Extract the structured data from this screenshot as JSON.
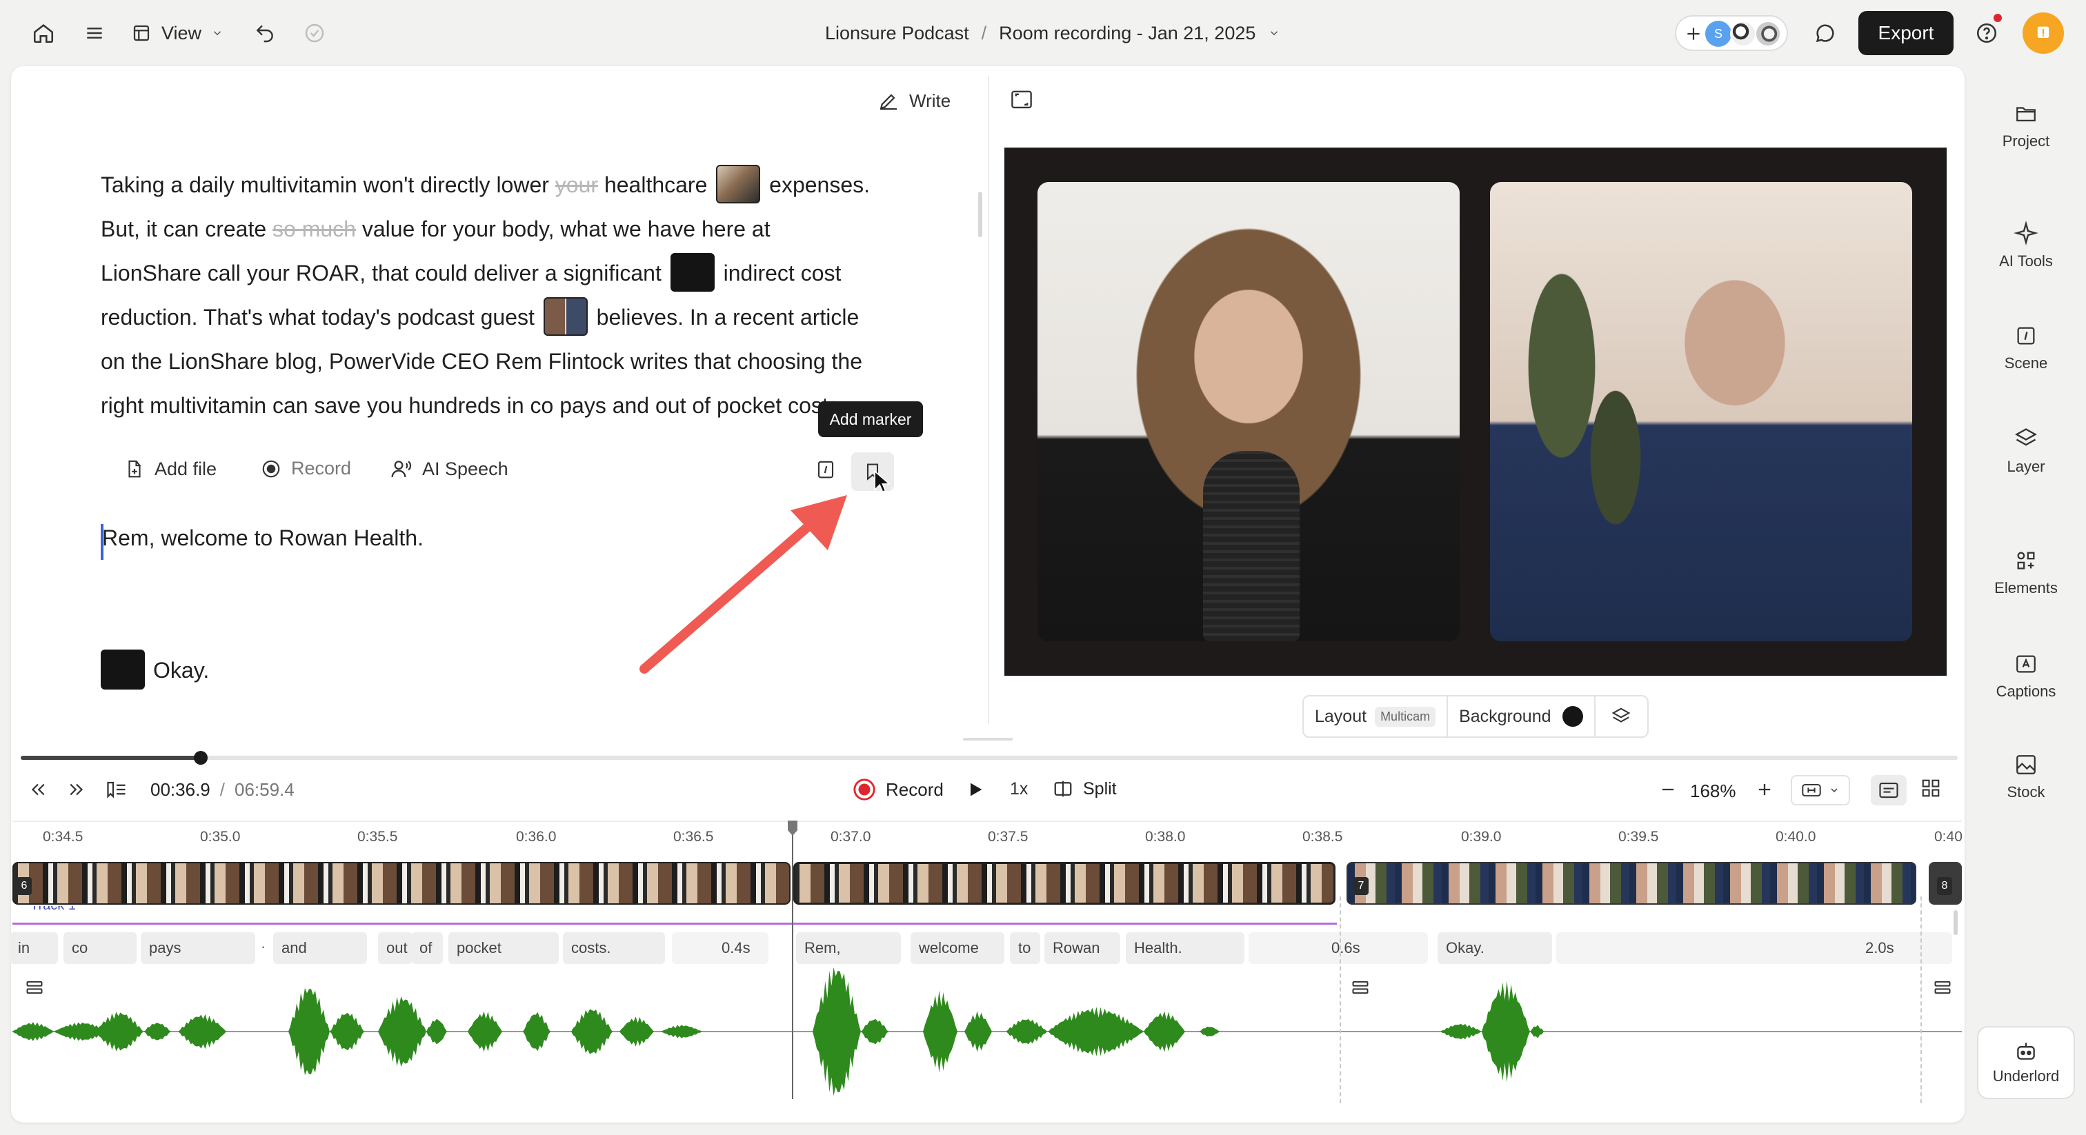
{
  "topbar": {
    "view_label": "View",
    "project_name": "Lionsure Podcast",
    "breadcrumb_sep": "/",
    "recording_name": "Room recording - Jan 21, 2025",
    "avatar_initial": "S",
    "export_label": "Export"
  },
  "editor": {
    "write_label": "Write",
    "paragraph1": {
      "l1a": "Taking a daily multivitamin won't directly lower",
      "l1_struck": "your",
      "l1b": "healthcare",
      "l1c": "expenses.",
      "l2a": "But, it can create",
      "l2_struck": "so much",
      "l2b": "value for your body, what we have here at",
      "l3a": "LionShare call your ROAR, that could deliver a significant",
      "l3b": "indirect cost",
      "l4a": "reduction. That's what today's podcast guest",
      "l4b": "believes. In a recent article",
      "l5": "on the LionShare blog, PowerVide CEO Rem Flintock writes that choosing the",
      "l6a": "right multivitamin can save you hundreds",
      "l6b": "in co pays and out of pocket costs."
    },
    "toolbar": {
      "add_file": "Add file",
      "record": "Record",
      "ai_speech": "AI Speech"
    },
    "tooltip": "Add marker",
    "paragraph2": "Rem, welcome to Rowan Health.",
    "paragraph3": "Okay."
  },
  "preview": {
    "layout_label": "Layout",
    "layout_value": "Multicam",
    "background_label": "Background",
    "background_color": "#1d1a19"
  },
  "sidebar": {
    "items": [
      {
        "label": "Project",
        "icon": "folder-icon"
      },
      {
        "label": "AI Tools",
        "icon": "sparkle-icon"
      },
      {
        "label": "Scene",
        "icon": "scene-icon"
      },
      {
        "label": "Layer",
        "icon": "layers-icon"
      },
      {
        "label": "Elements",
        "icon": "elements-icon"
      },
      {
        "label": "Captions",
        "icon": "captions-icon"
      },
      {
        "label": "Stock",
        "icon": "stock-icon"
      }
    ],
    "underlord_label": "Underlord"
  },
  "playback": {
    "current_time": "00:36.9",
    "sep": "/",
    "total_time": "06:59.4",
    "record_label": "Record",
    "speed": "1x",
    "split_label": "Split",
    "zoom": "168%",
    "progress": 0.093
  },
  "timeline": {
    "ruler": [
      "0:34.5",
      "0:35.0",
      "0:35.5",
      "0:36.0",
      "0:36.5",
      "0:37.0",
      "0:37.5",
      "0:38.0",
      "0:38.5",
      "0:39.0",
      "0:39.5",
      "0:40.0",
      "0:40"
    ],
    "clip_numbers": [
      "6",
      "7",
      "8"
    ],
    "track_label": "Track 1",
    "words": [
      "in",
      "co",
      "pays",
      "and",
      "out",
      "of",
      "pocket",
      "costs.",
      "Rem,",
      "welcome",
      "to",
      "Rowan",
      "Health.",
      "Okay."
    ],
    "gaps": [
      "0.4s",
      "0.6s",
      "2.0s"
    ],
    "dot": "·"
  },
  "colors": {
    "waveform": "#2f8a1e",
    "accent_record": "#e0262d",
    "arrow": "#ef5b52",
    "notif": "#f6a623"
  }
}
